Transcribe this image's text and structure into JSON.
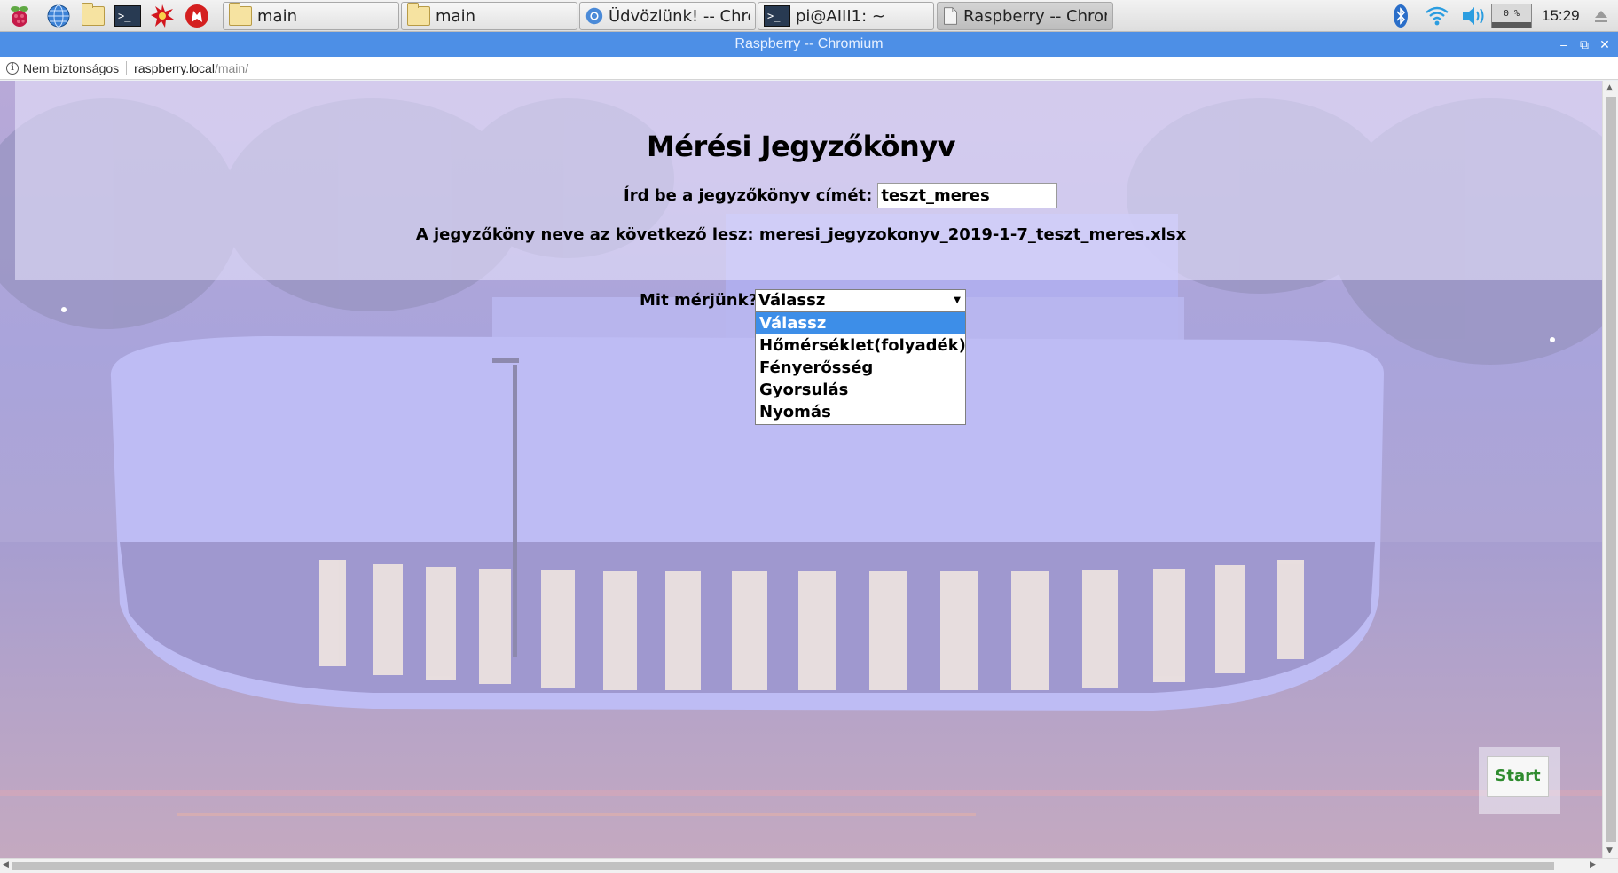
{
  "taskbar": {
    "launchers": [
      {
        "name": "raspberry-menu-icon"
      },
      {
        "name": "web-browser-icon"
      },
      {
        "name": "file-manager-icon"
      },
      {
        "name": "terminal-icon"
      },
      {
        "name": "mathematica-icon"
      },
      {
        "name": "wolfram-icon"
      }
    ],
    "tasks": [
      {
        "label": "main",
        "icon": "folder-icon"
      },
      {
        "label": "main",
        "icon": "folder-icon"
      },
      {
        "label": "Üdvözlünk! -- Chromi...",
        "icon": "chromium-icon"
      },
      {
        "label": "pi@AIII1: ~",
        "icon": "terminal-icon"
      },
      {
        "label": "Raspberry -- Chromiu...",
        "icon": "document-icon",
        "active": true
      }
    ],
    "tray": {
      "cpu_label": "0 %",
      "clock": "15:29"
    }
  },
  "window": {
    "title": "Raspberry -- Chromium"
  },
  "urlbar": {
    "security": "Nem biztonságos",
    "host": "raspberry.local",
    "path": "/main/"
  },
  "page": {
    "title": "Mérési Jegyzőkönyv",
    "name_label": "Írd be a jegyzőkönyv címét:",
    "name_value": "teszt_meres",
    "filename_text": "A jegyzőköny neve az következő lesz: meresi_jegyzokonyv_2019-1-7_teszt_meres.xlsx",
    "measure_label": "Mit mérjünk?",
    "select_value": "Válassz",
    "options": [
      "Válassz",
      "Hőmérséklet(folyadék)",
      "Fényerősség",
      "Gyorsulás",
      "Nyomás"
    ],
    "start_label": "Start"
  },
  "colors": {
    "titlebar": "#4d8fe6",
    "selected_option": "#3d8ee8",
    "start_text": "#2e8b2e"
  }
}
